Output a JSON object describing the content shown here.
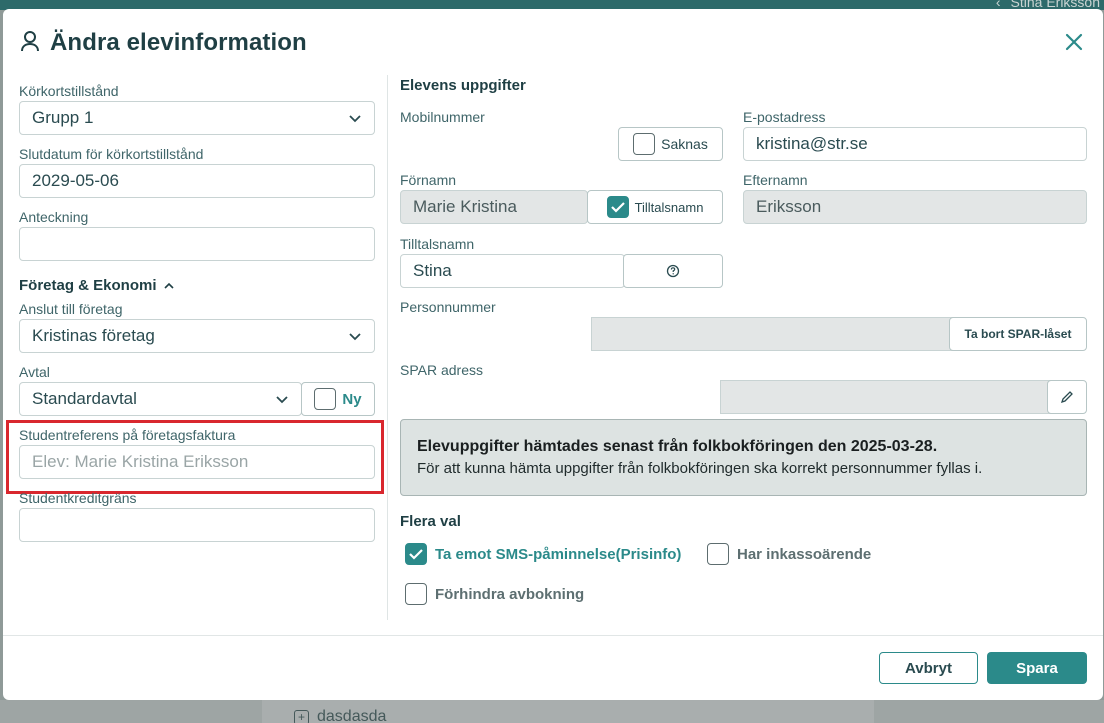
{
  "background": {
    "user_name": "Stina Eriksson",
    "list_item": "dasdasda"
  },
  "modal": {
    "title": "Ändra elevinformation",
    "close_label": "×"
  },
  "left": {
    "license_label": "Körkortstillstånd",
    "license_value": "Grupp 1",
    "end_date_label": "Slutdatum för körkortstillstånd",
    "end_date_value": "2029-05-06",
    "note_label": "Anteckning",
    "note_value": "",
    "company_section": "Företag & Ekonomi",
    "company_label": "Anslut till företag",
    "company_value": "Kristinas företag",
    "agreement_label": "Avtal",
    "agreement_value": "Standardavtal",
    "agreement_new": "Ny",
    "ref_label": "Studentreferens på företagsfaktura",
    "ref_placeholder": "Elev: Marie Kristina Eriksson",
    "credit_label": "Studentkreditgräns",
    "credit_value": ""
  },
  "right": {
    "section_title": "Elevens uppgifter",
    "mobile_label": "Mobilnummer",
    "mobile_value": "",
    "missing_label": "Saknas",
    "email_label": "E-postadress",
    "email_value": "kristina@str.se",
    "firstname_label": "Förnamn",
    "firstname_value": "Marie Kristina",
    "nickname_toggle": "Tilltalsnamn",
    "lastname_label": "Efternamn",
    "lastname_value": "Eriksson",
    "nickname_label": "Tilltalsnamn",
    "nickname_value": "Stina",
    "ssn_label": "Personnummer",
    "ssn_remove": "Ta bort SPAR-låset",
    "spar_label": "SPAR adress",
    "info_title": "Elevuppgifter hämtades senast från folkbokföringen den 2025-03-28.",
    "info_text": "För att kunna hämta uppgifter från folkbokföringen ska korrekt personnummer fyllas i.",
    "more_title": "Flera val",
    "opt_sms": "Ta emot SMS-påminnelse(Prisinfo)",
    "opt_debt": "Har inkassoärende",
    "opt_prevent": "Förhindra avbokning"
  },
  "footer": {
    "cancel": "Avbryt",
    "save": "Spara"
  },
  "colors": {
    "accent": "#2b8a8a",
    "highlight": "#d9272e"
  }
}
